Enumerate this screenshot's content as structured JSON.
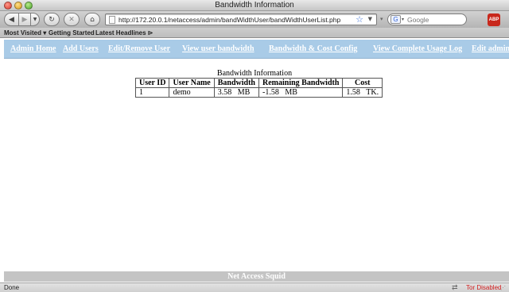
{
  "window": {
    "title": "Bandwidth Information"
  },
  "toolbar": {
    "back_icon": "◀",
    "forward_icon": "▶",
    "history_icon": "▼",
    "reload_icon": "↻",
    "stop_icon": "✕",
    "home_icon": "⌂",
    "url": "http://172.20.0.1/netaccess/admin/bandWidthUser/bandWidthUserList.php",
    "star_icon": "☆",
    "dropdown_icon": "▼",
    "rss_icon": "▾",
    "search_engine_icon": "G",
    "search_caret_icon": "▾",
    "search_placeholder": "Google",
    "abp_label": "ABP"
  },
  "bookmarks": {
    "most_visited": "Most Visited ▾",
    "getting_started": "Getting Started",
    "latest_headlines": "Latest Headlines ⊳"
  },
  "nav": {
    "admin_home": "Admin Home",
    "add_users": "Add Users",
    "edit_remove_user": "Edit/Remove User",
    "view_user_bandwidth": "View user bandwidth",
    "bandwidth_cost_config": "Bandwidth & Cost Config",
    "view_complete_usage_log": "View Complete Usage Log",
    "edit_admin": "Edit admin"
  },
  "content": {
    "caption": "Bandwidth Information",
    "columns": [
      "User ID",
      "User Name",
      "Bandwidth",
      "Remaining Bandwidth",
      "Cost"
    ],
    "rows": [
      [
        "1",
        "demo",
        "3.58   MB",
        "-1.58   MB",
        "1.58   TK."
      ]
    ]
  },
  "footer": {
    "text": "Net Access Squid"
  },
  "statusbar": {
    "status": "Done",
    "net_icon": "⇄",
    "tor": "Tor Disabled",
    "grip_icon": "⋰"
  },
  "colors": {
    "nav_background": "#a9cbe7",
    "nav_link": "#ffffff",
    "footer_background": "#c4c4c4",
    "tor_status": "#d21d1d"
  }
}
